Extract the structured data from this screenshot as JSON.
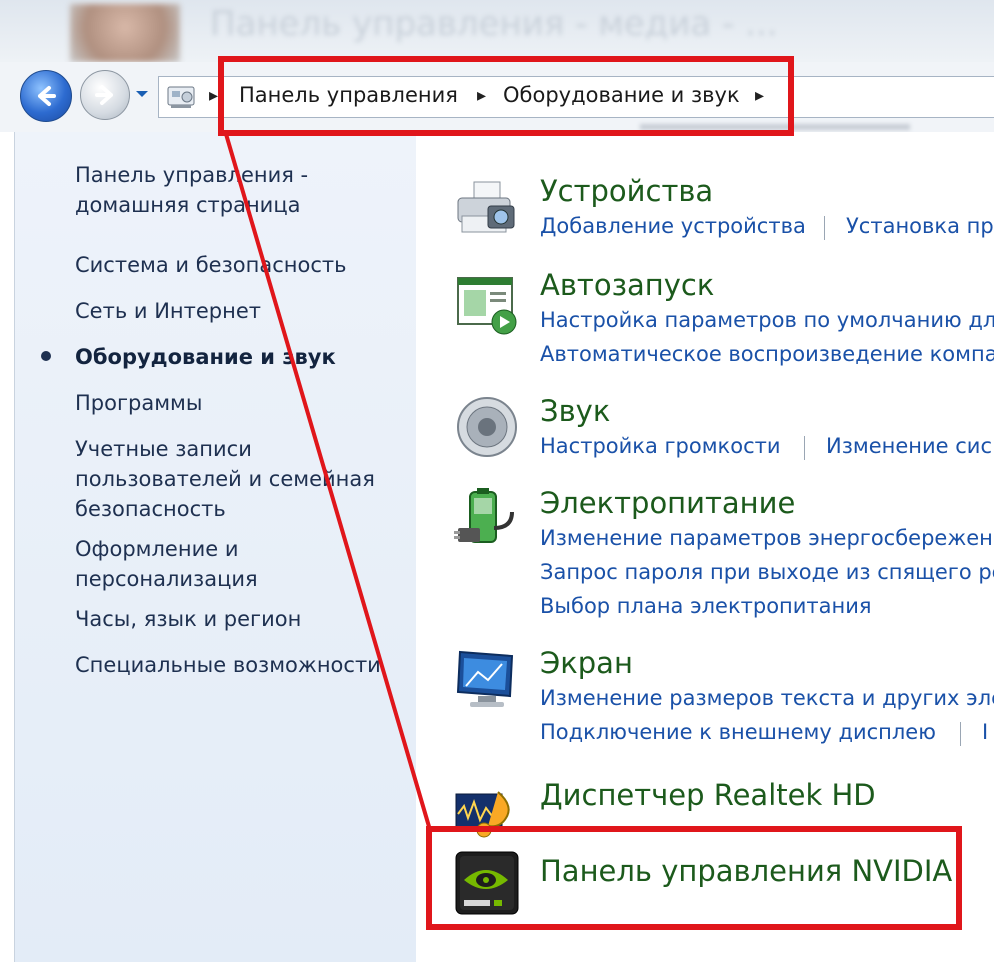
{
  "window": {
    "title_blurred": "Панель управления - медиа - ..."
  },
  "nav": {
    "back_icon": "back-arrow-icon",
    "forward_icon": "forward-arrow-icon",
    "breadcrumb": [
      "Панель управления",
      "Оборудование и звук"
    ]
  },
  "sidebar": {
    "items": [
      {
        "label": "Панель управления -\nдомашняя страница",
        "active": false
      },
      {
        "label": "Система и безопасность",
        "active": false
      },
      {
        "label": "Сеть и Интернет",
        "active": false
      },
      {
        "label": "Оборудование и звук",
        "active": true
      },
      {
        "label": "Программы",
        "active": false
      },
      {
        "label": "Учетные записи\nпользователей и семейная\nбезопасность",
        "active": false
      },
      {
        "label": "Оформление и\nперсонализация",
        "active": false
      },
      {
        "label": "Часы, язык и регион",
        "active": false
      },
      {
        "label": "Специальные возможности",
        "active": false
      }
    ]
  },
  "categories": [
    {
      "title": "Устройства",
      "icon": "devices-printer-icon",
      "links": [
        "Добавление устройства",
        "Установка пр"
      ]
    },
    {
      "title": "Автозапуск",
      "icon": "autoplay-icon",
      "links": [
        "Настройка параметров по умолчанию дл",
        "Автоматическое воспроизведение компа"
      ]
    },
    {
      "title": "Звук",
      "icon": "speaker-icon",
      "links": [
        "Настройка громкости",
        "Изменение сис"
      ]
    },
    {
      "title": "Электропитание",
      "icon": "power-battery-icon",
      "links": [
        "Изменение параметров энергосбережен",
        "Запрос пароля при выходе из спящего ре",
        "Выбор плана электропитания"
      ]
    },
    {
      "title": "Экран",
      "icon": "display-monitor-icon",
      "links": [
        "Изменение размеров текста и других эле",
        "Подключение к внешнему дисплею",
        "I"
      ]
    },
    {
      "title": "Диспетчер Realtek HD",
      "icon": "realtek-audio-icon",
      "links": []
    },
    {
      "title": "Панель управления NVIDIA",
      "icon": "nvidia-icon",
      "links": []
    }
  ],
  "colors": {
    "highlight": "#e0161b",
    "category_title": "#1c5a1c",
    "link": "#1a51a8",
    "sidebar_text": "#1e3050"
  }
}
